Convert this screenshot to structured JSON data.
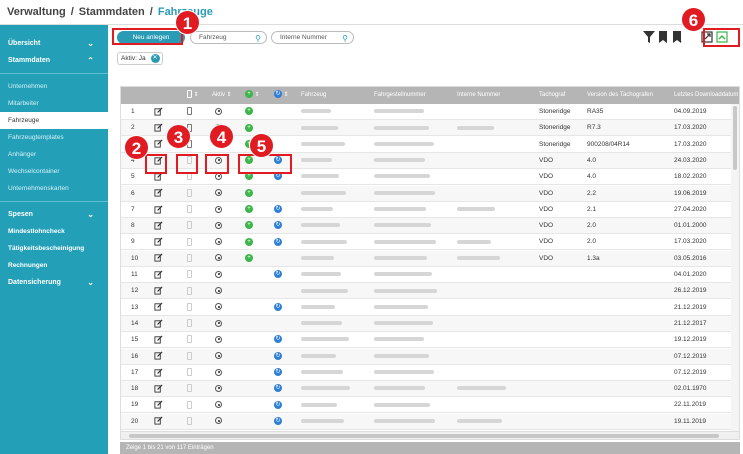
{
  "breadcrumb": {
    "items": [
      "Verwaltung",
      "Stammdaten"
    ],
    "current": "Fahrzeuge",
    "separator": "/"
  },
  "sidebar": {
    "sections": [
      {
        "label": "Übersicht",
        "items": []
      },
      {
        "label": "Stammdaten",
        "items": [
          "Unternehmen",
          "Mitarbeiter",
          "Fahrzeuge",
          "Fahrzeugtemplates",
          "Anhänger",
          "Wechselcontainer",
          "Unternehmenskarten"
        ],
        "active": "Fahrzeuge"
      },
      {
        "label": "Spesen",
        "items": [
          "Mindestlohncheck",
          "Tätigkeitsbescheinigung",
          "Rechnungen"
        ]
      },
      {
        "label": "Datensicherung",
        "items": []
      }
    ]
  },
  "toolbar": {
    "new_label": "Neu anlegen",
    "search_fahrzeug": "Fahrzeug",
    "search_intern": "Interne Nummer",
    "filter_chip": "Aktiv: Ja"
  },
  "table": {
    "columns": [
      "Aktiv",
      "Fahrzeug",
      "Fahrgestellnummer",
      "Interne Nummer",
      "Tachograf",
      "Version des Tachografen",
      "Letztes Downloaddatum"
    ],
    "rows": [
      {
        "n": "1",
        "tacho": "Stoneridge",
        "ver": "RA35",
        "date": "04.09.2019",
        "g": true,
        "b": false,
        "intern": false
      },
      {
        "n": "2",
        "tacho": "Stoneridge",
        "ver": "R7.3",
        "date": "17.03.2020",
        "g": true,
        "b": false,
        "intern": true
      },
      {
        "n": "3",
        "tacho": "Stoneridge",
        "ver": "900208/04R14",
        "date": "17.03.2020",
        "g": true,
        "b": false,
        "intern": false
      },
      {
        "n": "4",
        "tacho": "VDO",
        "ver": "4.0",
        "date": "24.03.2020",
        "g": true,
        "b": true,
        "intern": false
      },
      {
        "n": "5",
        "tacho": "VDO",
        "ver": "4.0",
        "date": "18.02.2020",
        "g": true,
        "b": true,
        "intern": false
      },
      {
        "n": "6",
        "tacho": "VDO",
        "ver": "2.2",
        "date": "19.06.2019",
        "g": true,
        "b": false,
        "intern": false
      },
      {
        "n": "7",
        "tacho": "VDO",
        "ver": "2.1",
        "date": "27.04.2020",
        "g": true,
        "b": true,
        "intern": true
      },
      {
        "n": "8",
        "tacho": "VDO",
        "ver": "2.0",
        "date": "01.01.2000",
        "g": true,
        "b": true,
        "intern": false
      },
      {
        "n": "9",
        "tacho": "VDO",
        "ver": "2.0",
        "date": "17.03.2020",
        "g": true,
        "b": true,
        "intern": true
      },
      {
        "n": "10",
        "tacho": "VDO",
        "ver": "1.3a",
        "date": "03.05.2016",
        "g": true,
        "b": false,
        "intern": true
      },
      {
        "n": "11",
        "tacho": "",
        "ver": "",
        "date": "04.01.2020",
        "g": false,
        "b": true,
        "intern": false
      },
      {
        "n": "12",
        "tacho": "",
        "ver": "",
        "date": "26.12.2019",
        "g": false,
        "b": false,
        "intern": false
      },
      {
        "n": "13",
        "tacho": "",
        "ver": "",
        "date": "21.12.2019",
        "g": false,
        "b": true,
        "intern": false
      },
      {
        "n": "14",
        "tacho": "",
        "ver": "",
        "date": "21.12.2017",
        "g": false,
        "b": false,
        "intern": false
      },
      {
        "n": "15",
        "tacho": "",
        "ver": "",
        "date": "19.12.2019",
        "g": false,
        "b": true,
        "intern": false
      },
      {
        "n": "16",
        "tacho": "",
        "ver": "",
        "date": "07.12.2019",
        "g": false,
        "b": true,
        "intern": false
      },
      {
        "n": "17",
        "tacho": "",
        "ver": "",
        "date": "07.12.2019",
        "g": false,
        "b": true,
        "intern": false
      },
      {
        "n": "18",
        "tacho": "",
        "ver": "",
        "date": "02.01.1970",
        "g": false,
        "b": true,
        "intern": true
      },
      {
        "n": "19",
        "tacho": "",
        "ver": "",
        "date": "22.11.2019",
        "g": false,
        "b": true,
        "intern": false
      },
      {
        "n": "20",
        "tacho": "",
        "ver": "",
        "date": "19.11.2019",
        "g": false,
        "b": true,
        "intern": true
      }
    ]
  },
  "footer": {
    "text": "Zeige 1 bis 21 von 117 Einträgen"
  },
  "callouts": [
    "1",
    "2",
    "3",
    "4",
    "5",
    "6"
  ],
  "colors": {
    "accent": "#2a9bb5",
    "sidebar": "#23a0b8",
    "callout": "#e01b22",
    "green": "#3cb54a",
    "blue": "#2f7fd6"
  }
}
